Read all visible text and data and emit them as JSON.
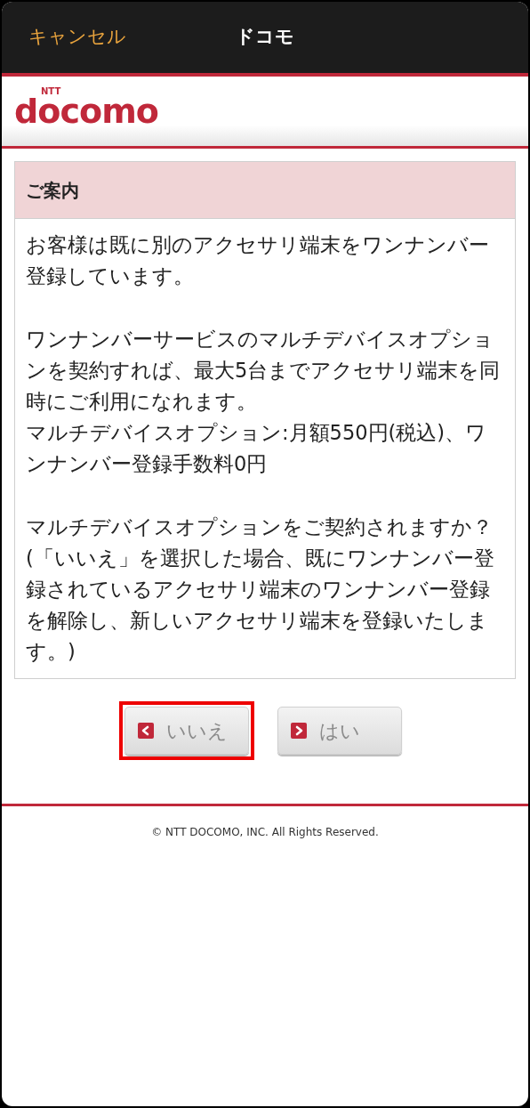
{
  "nav_bar": {
    "cancel": "キャンセル",
    "title": "ドコモ"
  },
  "logo": {
    "small": "NTT",
    "main": "docomo"
  },
  "notice": {
    "heading": "ご案内",
    "paragraphs": [
      [
        "お客様は既に別のアクセサリ端末をワンナンバー登録しています。"
      ],
      [
        "ワンナンバーサービスのマルチデバイスオプションを契約すれば、最大5台までアクセサリ端末を同時にご利用になれます。",
        "マルチデバイスオプション:月額550円(税込)、ワンナンバー登録手数料0円"
      ],
      [
        "マルチデバイスオプションをご契約されますか？",
        "(「いいえ」を選択した場合、既にワンナンバー登録されているアクセサリ端末のワンナンバー登録を解除し、新しいアクセサリ端末を登録いたします。)"
      ]
    ]
  },
  "buttons": [
    {
      "label": "いいえ",
      "kind": "back",
      "highlighted": true
    },
    {
      "label": "はい",
      "kind": "forward",
      "highlighted": false
    }
  ],
  "footer": "© NTT DOCOMO, INC. All Rights Reserved."
}
